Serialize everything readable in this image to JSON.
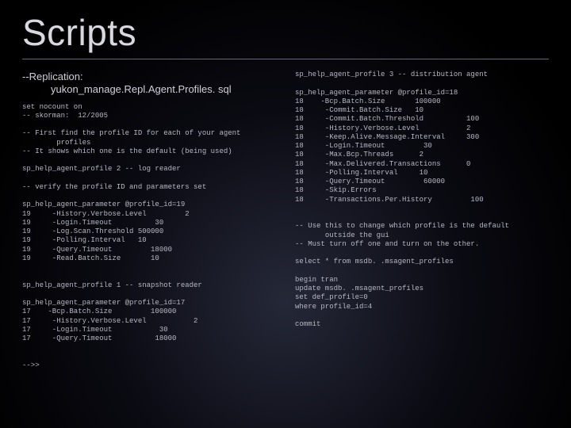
{
  "title": "Scripts",
  "left": {
    "subhead_line1": "--Replication:",
    "subhead_line2": "yukon_manage.Repl.Agent.Profiles. sql",
    "code": "set nocount on\n-- skorman:  12/2005\n\n-- First find the profile ID for each of your agent\n        profiles\n-- It shows which one is the default (being used)\n\nsp_help_agent_profile 2 -- log reader\n\n-- verify the profile ID and parameters set\n\nsp_help_agent_parameter @profile_id=19\n19     -History.Verbose.Level         2\n19     -Login.Timeout          30\n19     -Log.Scan.Threshold 500000\n19     -Polling.Interval   10\n19     -Query.Timeout         18000\n19     -Read.Batch.Size       10\n\n\nsp_help_agent_profile 1 -- snapshot reader\n\nsp_help_agent_parameter @profile_id=17\n17    -Bcp.Batch.Size         100000\n17     -History.Verbose.Level           2\n17     -Login.Timeout           30\n17     -Query.Timeout          18000\n\n\n-->>"
  },
  "right": {
    "code": "sp_help_agent_profile 3 -- distribution agent\n\nsp_help_agent_parameter @profile_id=18\n18    -Bcp.Batch.Size       100000\n18     -Commit.Batch.Size   10\n18     -Commit.Batch.Threshold          100\n18     -History.Verbose.Level           2\n18     -Keep.Alive.Message.Interval     300\n18     -Login.Timeout         30\n18     -Max.Bcp.Threads      2\n18     -Max.Delivered.Transactions      0\n18     -Polling.Interval     10\n18     -Query.Timeout         60000\n18     -Skip.Errors\n18     -Transactions.Per.History         100\n\n\n-- Use this to change which profile is the default\n       outside the gui\n-- Must turn off one and turn on the other.\n\nselect * from msdb. .msagent_profiles\n\nbegin tran\nupdate msdb. .msagent_profiles\nset def_profile=0\nwhere profile_id=4\n\ncommit"
  }
}
